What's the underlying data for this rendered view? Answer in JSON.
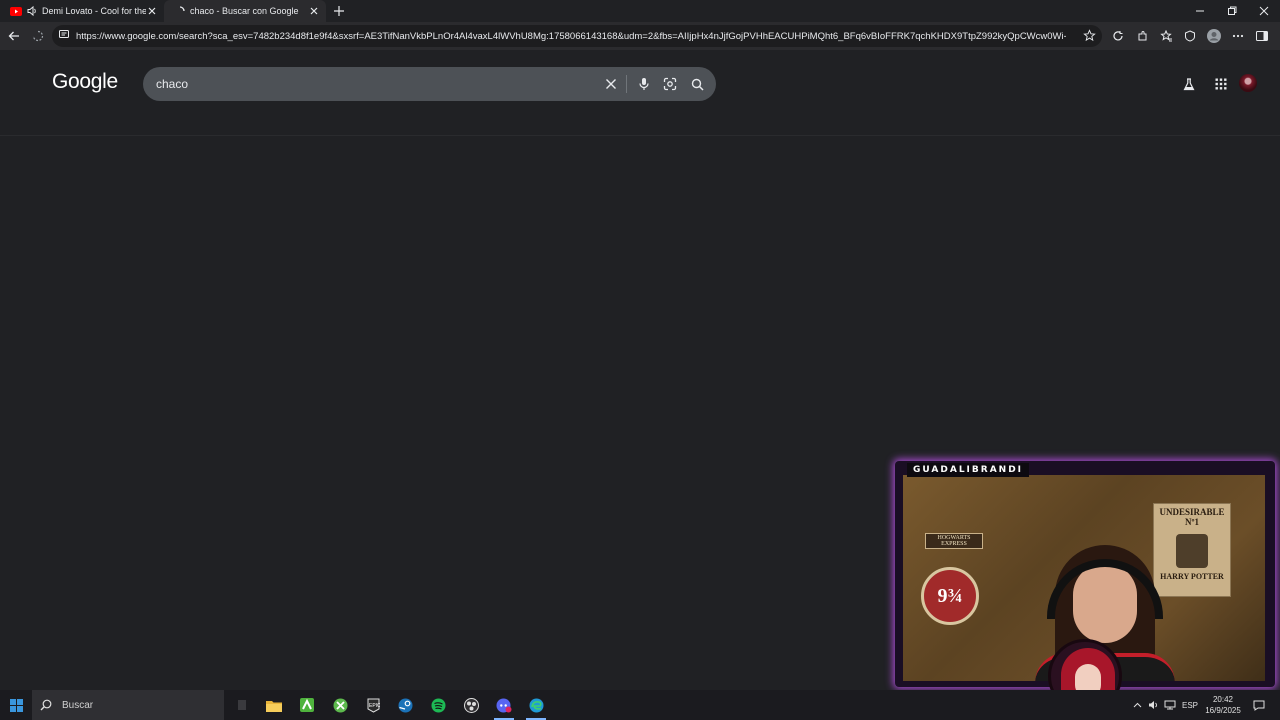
{
  "browser": {
    "tabs": [
      {
        "title": "Demi Lovato - Cool for the S",
        "active": false,
        "audio": true
      },
      {
        "title": "chaco - Buscar con Google",
        "active": true
      }
    ],
    "url": "https://www.google.com/search?sca_esv=7482b234d8f1e9f4&sxsrf=AE3TifNanVkbPLnOr4Al4vaxL4lWVhU8Mg:1758066143168&udm=2&fbs=AIIjpHx4nJjfGojPVHhEACUHPiMQht6_BFq6vBIoFFRK7qchKHDX9TtpZ992kyQpCWcw0Wi-YYs4nsdn..."
  },
  "google": {
    "logo": "Google",
    "query": "chaco"
  },
  "stream": {
    "channel_name": "GUADALIBRANDI",
    "poster_title": "UNDESIRABLE Nº1",
    "poster_name": "HARRY POTTER",
    "sign_label": "HOGWARTS EXPRESS",
    "platform_number": "9¾"
  },
  "taskbar": {
    "search_placeholder": "Buscar",
    "language": "ESP",
    "time": "20:42",
    "date": "16/9/2025"
  },
  "colors": {
    "page_bg": "#202124",
    "searchbox_bg": "#4d5156",
    "overlay_glow": "#a64bd0"
  }
}
